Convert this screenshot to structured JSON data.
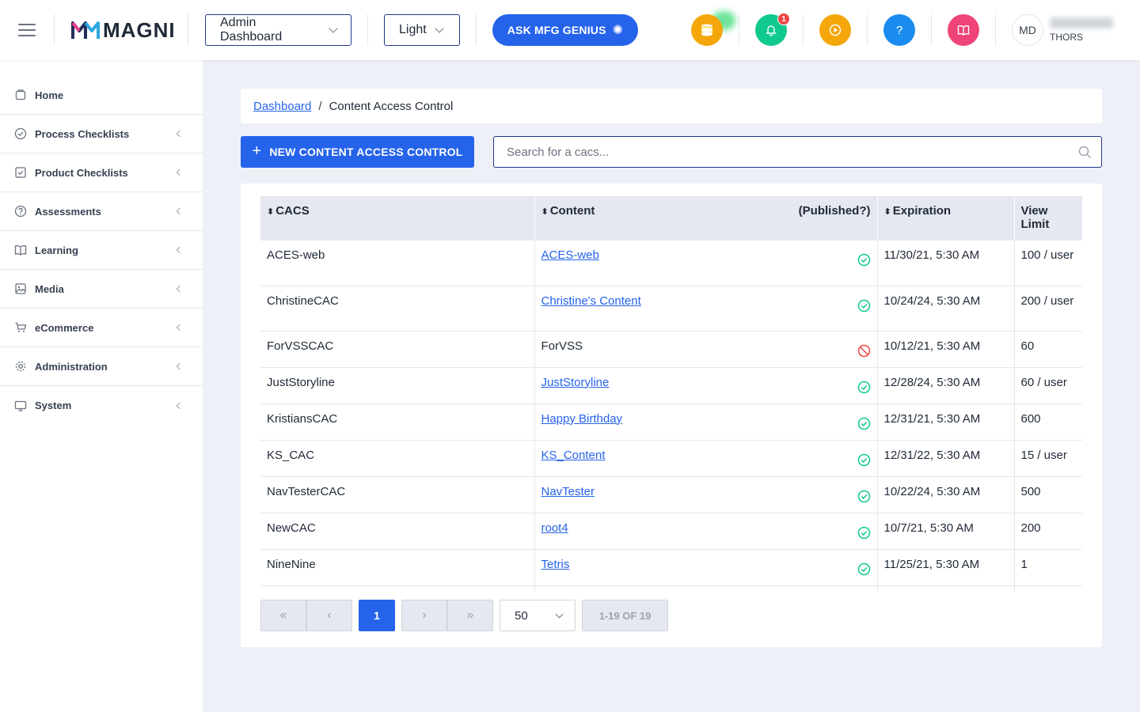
{
  "header": {
    "brand": "MAGNI",
    "dashboard_select": "Admin Dashboard",
    "theme_select": "Light",
    "ask_button": "ASK MFG GENIUS",
    "notification_count": "1",
    "help_label": "?",
    "avatar_initials": "MD",
    "user_org": "THORS",
    "icons": [
      "coins-icon",
      "bell-icon",
      "play-icon",
      "help-icon",
      "book-icon"
    ],
    "colors": {
      "coins": "#f5a60a",
      "bell": "#10c98f",
      "play": "#f5a60a",
      "help": "#1a8cf0",
      "book": "#ef4477",
      "primary": "#2563eb"
    }
  },
  "sidebar": {
    "items": [
      {
        "label": "Home",
        "icon": "home-icon"
      },
      {
        "label": "Process Checklists",
        "icon": "check-circle-icon"
      },
      {
        "label": "Product Checklists",
        "icon": "check-square-icon"
      },
      {
        "label": "Assessments",
        "icon": "question-circle-icon"
      },
      {
        "label": "Learning",
        "icon": "book-open-icon"
      },
      {
        "label": "Media",
        "icon": "image-icon"
      },
      {
        "label": "eCommerce",
        "icon": "cart-icon"
      },
      {
        "label": "Administration",
        "icon": "gear-icon"
      },
      {
        "label": "System",
        "icon": "monitor-icon"
      }
    ]
  },
  "breadcrumb": {
    "parent": "Dashboard",
    "separator": "/",
    "current": "Content Access Control"
  },
  "actions": {
    "new_button": "NEW CONTENT ACCESS CONTROL",
    "search_placeholder": "Search for a cacs..."
  },
  "table": {
    "headers": {
      "cacs": "CACS",
      "content": "Content",
      "published": "(Published?)",
      "expiration": "Expiration",
      "view_limit": "View Limit"
    },
    "rows": [
      {
        "cacs": "ACES-web",
        "content": "ACES-web",
        "linked": true,
        "published": true,
        "expiration": "11/30/21, 5:30 AM",
        "view_limit": "100 / user"
      },
      {
        "cacs": "ChristineCAC",
        "content": "Christine's Content",
        "linked": true,
        "published": true,
        "expiration": "10/24/24, 5:30 AM",
        "view_limit": "200 / user"
      },
      {
        "cacs": "ForVSSCAC",
        "content": "ForVSS",
        "linked": false,
        "published": false,
        "expiration": "10/12/21, 5:30 AM",
        "view_limit": "60"
      },
      {
        "cacs": "JustStoryline",
        "content": "JustStoryline",
        "linked": true,
        "published": true,
        "expiration": "12/28/24, 5:30 AM",
        "view_limit": "60 / user"
      },
      {
        "cacs": "KristiansCAC",
        "content": "Happy Birthday",
        "linked": true,
        "published": true,
        "expiration": "12/31/21, 5:30 AM",
        "view_limit": "600"
      },
      {
        "cacs": "KS_CAC",
        "content": "KS_Content",
        "linked": true,
        "published": true,
        "expiration": "12/31/22, 5:30 AM",
        "view_limit": "15 / user"
      },
      {
        "cacs": "NavTesterCAC",
        "content": "NavTester",
        "linked": true,
        "published": true,
        "expiration": "10/22/24, 5:30 AM",
        "view_limit": "500"
      },
      {
        "cacs": "NewCAC",
        "content": "root4",
        "linked": true,
        "published": true,
        "expiration": "10/7/21, 5:30 AM",
        "view_limit": "200"
      },
      {
        "cacs": "NineNine",
        "content": "Tetris",
        "linked": true,
        "published": true,
        "expiration": "11/25/21, 5:30 AM",
        "view_limit": "1"
      }
    ]
  },
  "pagination": {
    "current_page": "1",
    "page_size": "50",
    "range": "1-19 OF 19"
  }
}
